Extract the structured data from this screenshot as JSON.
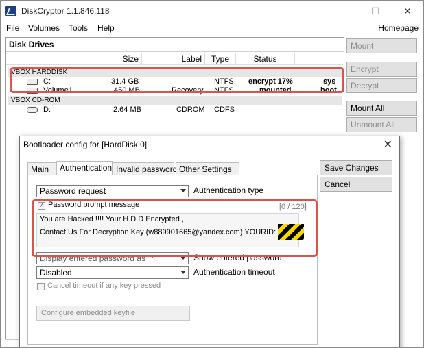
{
  "window": {
    "title": "DiskCryptor 1.1.846.118",
    "minimize": "—",
    "maximize": "☐",
    "close": "✕"
  },
  "menu": {
    "file": "File",
    "volumes": "Volumes",
    "tools": "Tools",
    "help": "Help",
    "homepage": "Homepage"
  },
  "disk_panel": {
    "title": "Disk Drives",
    "columns": {
      "size": "Size",
      "label": "Label",
      "type": "Type",
      "status": "Status"
    },
    "groups": [
      {
        "name": "VBOX HARDDISK"
      },
      {
        "name": "VBOX CD-ROM"
      }
    ],
    "rows": [
      {
        "name": "C:",
        "size": "31.4 GB",
        "label": "",
        "type": "NTFS",
        "status": "encrypt 17%",
        "flag": "sys"
      },
      {
        "name": "Volume1",
        "size": "450 MB",
        "label": "Recovery",
        "type": "NTFS",
        "status": "mounted",
        "flag": "boot"
      },
      {
        "name": "D:",
        "size": "2.64 MB",
        "label": "CDROM",
        "type": "CDFS",
        "status": "",
        "flag": ""
      }
    ]
  },
  "side_buttons": {
    "mount": "Mount",
    "encrypt": "Encrypt",
    "decrypt": "Decrypt",
    "mount_all": "Mount All",
    "unmount_all": "Unmount All"
  },
  "dialog": {
    "title": "Bootloader config for [HardDisk 0]",
    "close": "✕",
    "tabs": {
      "main": "Main",
      "authentication": "Authentication",
      "invalid_password": "Invalid password",
      "other_settings": "Other Settings"
    },
    "auth_method": "Password request",
    "auth_type_label": "Authentication type",
    "prompt_check_label": "Password prompt message",
    "counter": "[0 / 120]",
    "message_line1": "You are Hacked !!!! Your H.D.D Encrypted ,",
    "message_line2": "Contact Us For Decryption Key (w889901665@yandex.com) YOURID:",
    "show_password_value": "Display entered password as \"*\"",
    "show_password_label": "Show entered password",
    "timeout_value": "Disabled",
    "timeout_label": "Authentication timeout",
    "cancel_timeout_label": "Cancel timeout if any key pressed",
    "config_keyfile": "Configure embedded keyfile",
    "save": "Save Changes",
    "cancel": "Cancel"
  }
}
